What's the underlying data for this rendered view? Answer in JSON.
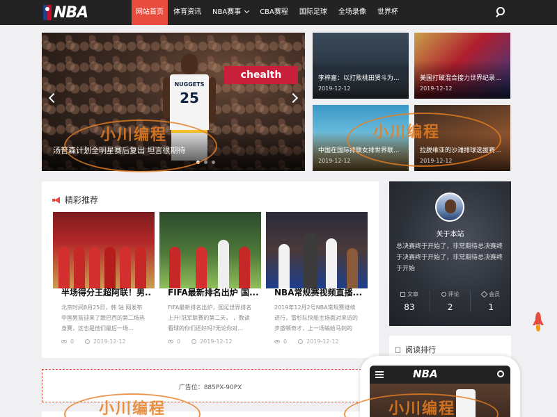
{
  "nav": {
    "logo": "NBA",
    "items": [
      {
        "label": "网站首页",
        "active": true,
        "dropdown": false
      },
      {
        "label": "体育资讯",
        "active": false,
        "dropdown": false
      },
      {
        "label": "NBA赛事",
        "active": false,
        "dropdown": true
      },
      {
        "label": "CBA赛程",
        "active": false,
        "dropdown": false
      },
      {
        "label": "国际足球",
        "active": false,
        "dropdown": false
      },
      {
        "label": "全场录像",
        "active": false,
        "dropdown": false
      },
      {
        "label": "世界杯",
        "active": false,
        "dropdown": false
      }
    ],
    "search_icon": "search-icon"
  },
  "hero": {
    "caption": "汤普森计划全明星赛后复出 坦言很期待",
    "banner": "chealth",
    "jersey_team": "NUGGETS",
    "jersey_number": "25",
    "slide_count": 3,
    "active_slide": 1
  },
  "tiles": [
    {
      "title": "李梓嘉：以打败桃田贤斗为...",
      "date": "2019-12-12"
    },
    {
      "title": "美国打破混合接力世界纪录...",
      "date": "2019-12-12"
    },
    {
      "title": "中国在国际排联女排世界联...",
      "date": "2019-12-12"
    },
    {
      "title": "拉脱维亚的沙滩排球选拔赛...",
      "date": "2019-12-12"
    }
  ],
  "recommend": {
    "heading": "精彩推荐",
    "posts": [
      {
        "title": "半场得分王超阿联！男...",
        "desc": "北京时间8月25日，韩 站 网发布中国男篮迎来了跟巴西的第二场热身赛，这也是他们最后一场...",
        "views": "0",
        "date": "2019-12-12"
      },
      {
        "title": "FIFA最新排名出炉 国...",
        "desc": "FIFA最新排名出炉，国足世界排名上升!冠军联赛的第二天， ，数读看球的你们还好吗?无论你对...",
        "views": "0",
        "date": "2019-12-12"
      },
      {
        "title": "NBA常规赛视频直播...",
        "desc": "2019年12月2号NBA常规赛继续进行，雷杉队快船主场面对来访的步盛顿奇才，上一场输给马刺的快...",
        "views": "0",
        "date": "2019-12-12"
      }
    ]
  },
  "ad": {
    "text": "广告位：885PX-90PX"
  },
  "about": {
    "title": "关于本站",
    "desc": "总决赛终于开始了，非常期待总决赛终于决赛终于开始了，非常期待总决赛终于开始",
    "stats": [
      {
        "label": "文章",
        "value": "83"
      },
      {
        "label": "评论",
        "value": "2"
      },
      {
        "label": "会员",
        "value": "1"
      }
    ]
  },
  "rank": {
    "heading": "阅读排行"
  },
  "phone": {
    "logo": "NBA"
  },
  "watermark": {
    "text": "小川编程"
  },
  "colors": {
    "accent": "#e74c3c",
    "nav_bg": "#232323",
    "page_bg": "#f0f0f2",
    "watermark": "#e67e22"
  }
}
